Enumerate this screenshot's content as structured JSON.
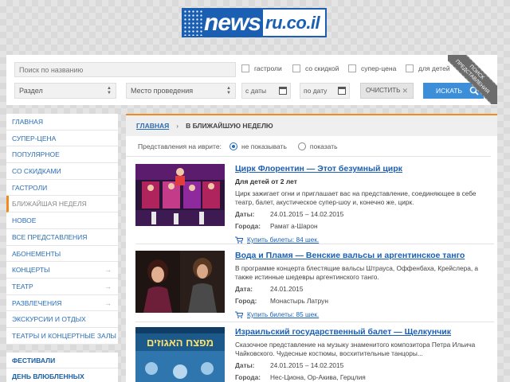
{
  "logo": {
    "main": "news",
    "tail": "ru.co.il"
  },
  "filters": {
    "search_placeholder": "Поиск по названию",
    "checkboxes": [
      "гастроли",
      "со скидкой",
      "супер-цена",
      "для детей"
    ],
    "section": "Раздел",
    "venue": "Место проведения",
    "date_from": "с даты",
    "date_to": "по дату",
    "clear": "ОЧИСТИТЬ",
    "search": "ИСКАТЬ",
    "ribbon_line1": "ПОИСК",
    "ribbon_line2": "ПРЕДСТАВЛЕНИЯ"
  },
  "sidebar": {
    "items": [
      {
        "label": "ГЛАВНАЯ"
      },
      {
        "label": "СУПЕР-ЦЕНА"
      },
      {
        "label": "ПОПУЛЯРНОЕ"
      },
      {
        "label": "СО СКИДКАМИ"
      },
      {
        "label": "ГАСТРОЛИ"
      },
      {
        "label": "БЛИЖАЙШАЯ НЕДЕЛЯ"
      },
      {
        "label": "НОВОЕ"
      },
      {
        "label": "ВСЕ ПРЕДСТАВЛЕНИЯ"
      },
      {
        "label": "АБОНЕМЕНТЫ"
      },
      {
        "label": "КОНЦЕРТЫ"
      },
      {
        "label": "ТЕАТР"
      },
      {
        "label": "РАЗВЛЕЧЕНИЯ"
      },
      {
        "label": "ЭКСКУРСИИ И ОТДЫХ"
      },
      {
        "label": "ТЕАТРЫ И КОНЦЕРТНЫЕ ЗАЛЫ"
      }
    ],
    "items2": [
      {
        "label": "ФЕСТИВАЛИ"
      },
      {
        "label": "ДЕНЬ ВЛЮБЛЕННЫХ"
      }
    ]
  },
  "breadcrumb": {
    "home": "ГЛАВНАЯ",
    "sep": "›",
    "current": "В БЛИЖАЙШУЮ НЕДЕЛЮ"
  },
  "hebrew": {
    "label": "Представления на иврите:",
    "opt1": "не показывать",
    "opt2": "показать"
  },
  "labels": {
    "dates": "Даты:",
    "date": "Дата:",
    "cities": "Города:",
    "city": "Город:"
  },
  "events": [
    {
      "title": "Цирк Флорентин — Этот безумный цирк",
      "sub": "Для детей от 2 лет",
      "desc": "Цирк зажигает огни и приглашает вас на представление, соединяющее в себе театр, балет, акустическое супер-шоу и, конечно же, цирк.",
      "dates": "24.01.2015 – 14.02.2015",
      "cities": "Рамат а-Шарон",
      "buy": "Купить билеты: 84 шек."
    },
    {
      "title": "Вода и Пламя — Венские вальсы и аргентинское танго",
      "desc": "В программе концерта блестящие вальсы Штрауса, Оффенбаха, Крейслера, а также истинные шедевры аргентинского танго.",
      "dates": "24.01.2015",
      "cities": "Монастырь Латрун",
      "buy": "Купить билеты: 85 шек."
    },
    {
      "title": "Израильский государственный балет — Щелкунчик",
      "desc": "Сказочное представление на музыку знаменитого композитора Петра Ильича Чайковского. Чудесные костюмы, восхитительные танцоры...",
      "dates": "24.01.2015 – 14.02.2015",
      "cities": "Нес-Циона, Ор-Акива, Герцлия",
      "thumb_text": "מפצח האגוזים"
    }
  ]
}
